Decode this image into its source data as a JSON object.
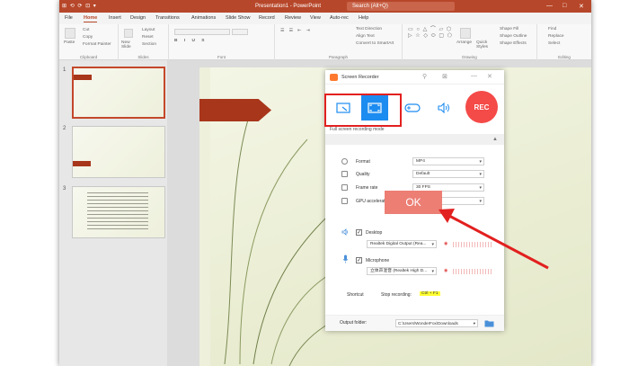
{
  "titlebar": {
    "quick_access": "⊞ ⟲ ⟳ ⊡ ▾",
    "doc_title": "Presentation1 - PowerPoint",
    "search_placeholder": "Search (Alt+Q)",
    "minimize": "—",
    "maximize": "□",
    "close": "✕"
  },
  "menu": {
    "file": "File",
    "home": "Home",
    "insert": "Insert",
    "design": "Design",
    "transitions": "Transitions",
    "animations": "Animations",
    "slideshow": "Slide Show",
    "record": "Record",
    "review": "Review",
    "view": "View",
    "autorec": "Auto-rec",
    "help": "Help"
  },
  "ribbon": {
    "paste": "Paste",
    "cut": "Cut",
    "copy": "Copy",
    "format_painter": "Format Painter",
    "clipboard": "Clipboard",
    "new_slide": "New Slide",
    "layout": "Layout",
    "reset": "Reset",
    "section": "Section",
    "slides": "Slides",
    "font": "Font",
    "paragraph": "Paragraph",
    "text_direction": "Text Direction",
    "align_text": "Align Text",
    "convert_smartart": "Convert to SmartArt",
    "arrange": "Arrange",
    "quick_styles": "Quick Styles",
    "shape_fill": "Shape Fill",
    "shape_outline": "Shape Outline",
    "shape_effects": "Shape Effects",
    "drawing": "Drawing",
    "find": "Find",
    "replace": "Replace",
    "select": "Select",
    "editing": "Editing"
  },
  "thumbs": {
    "n1": "1",
    "n2": "2",
    "n3": "3"
  },
  "recorder": {
    "title": "Screen Recorder",
    "rec_label": "REC",
    "mode_label": "Full screen recording mode",
    "format_label": "Format",
    "format_value": "MP4",
    "quality_label": "Quality",
    "quality_value": "Default",
    "framerate_label": "Frame rate",
    "framerate_value": "30 FPS",
    "gpu_label": "GPU accelerat",
    "desktop_label": "Desktop",
    "desktop_value": "Realtek Digital Output (Rea...",
    "mic_label": "Microphone",
    "mic_value": "立体声混音 (Realtek High D...",
    "shortcut_label": "Shortcut",
    "stop_label": "Stop recording:",
    "hotkey": "Ctrl + F1",
    "output_label": "Output folder:",
    "output_value": "C:\\Users\\WonderFox\\Downloads"
  },
  "ok_label": "OK",
  "colors": {
    "accent": "#b7472a",
    "highlight": "#e2201f",
    "mode_active": "#1d8cf0",
    "rec": "#f44a48"
  }
}
